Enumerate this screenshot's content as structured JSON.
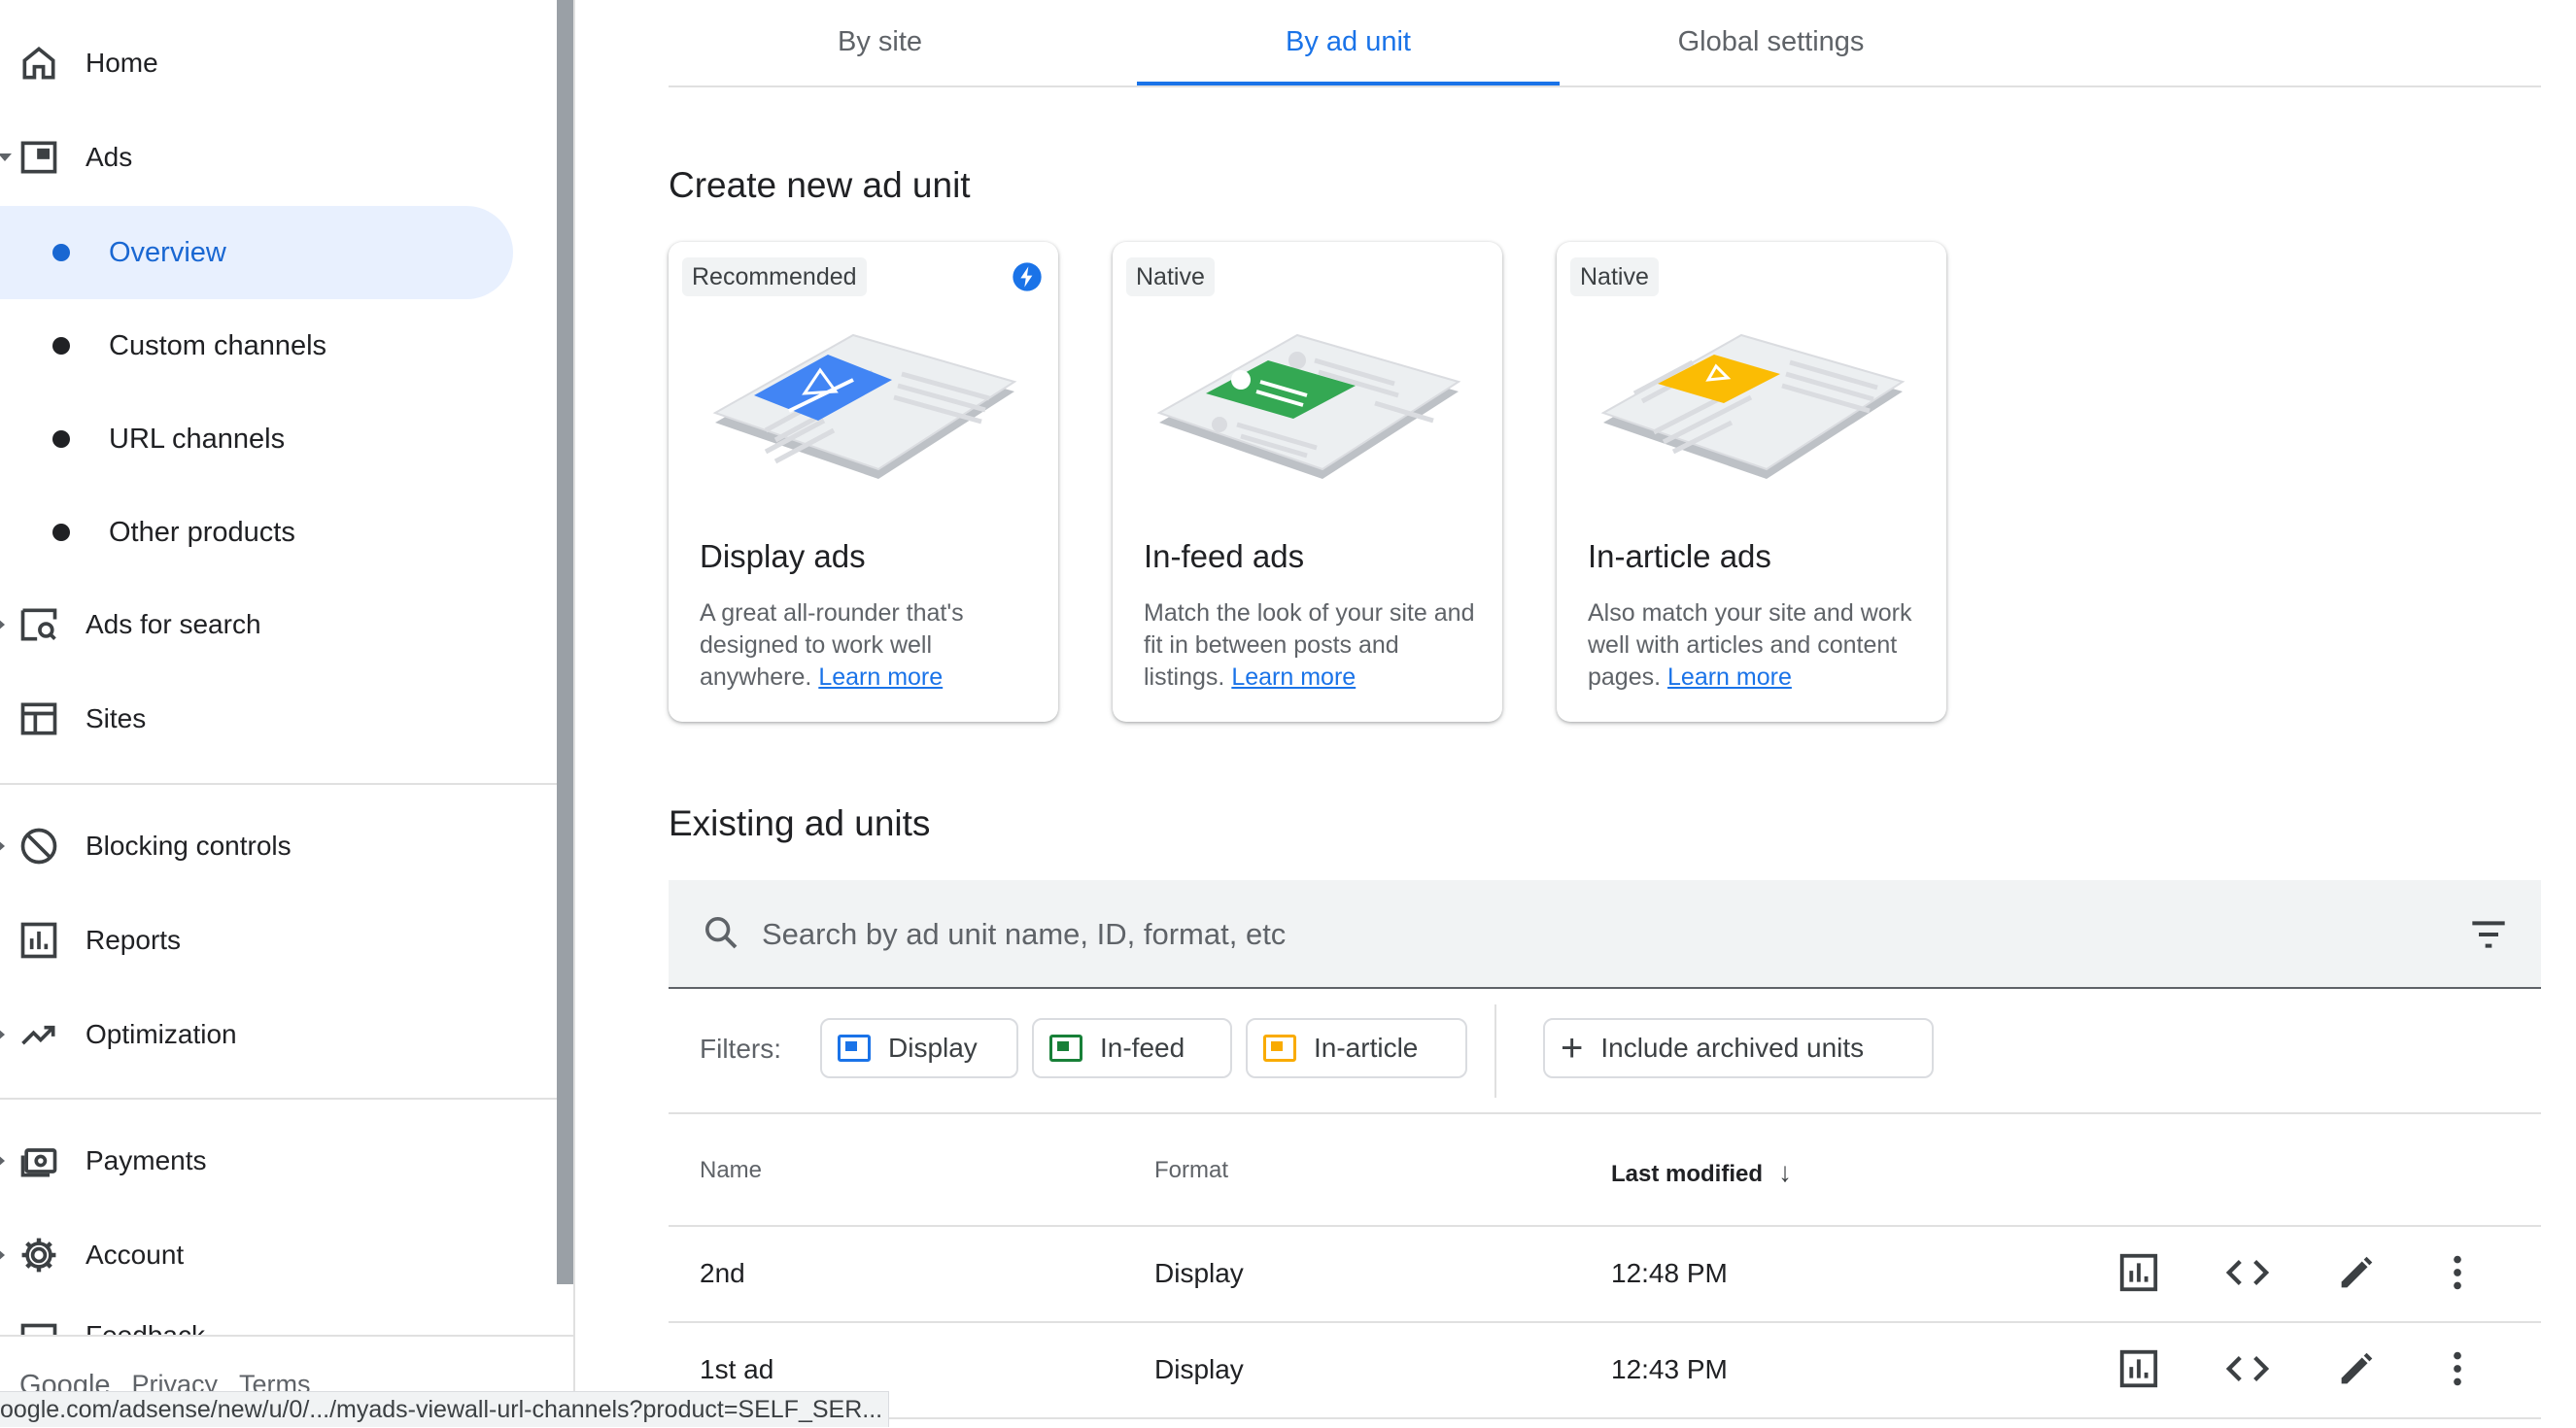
{
  "sidebar": {
    "items": [
      {
        "label": "Home",
        "icon": "home-icon"
      },
      {
        "label": "Ads",
        "icon": "ads-icon"
      },
      {
        "label": "Ads for search",
        "icon": "ads-for-search-icon"
      },
      {
        "label": "Sites",
        "icon": "sites-icon"
      },
      {
        "label": "Blocking controls",
        "icon": "block-icon"
      },
      {
        "label": "Reports",
        "icon": "reports-icon"
      },
      {
        "label": "Optimization",
        "icon": "trending-up-icon"
      },
      {
        "label": "Payments",
        "icon": "payments-icon"
      },
      {
        "label": "Account",
        "icon": "gear-icon"
      },
      {
        "label": "Feedback",
        "icon": "feedback-icon"
      }
    ],
    "sub_items": [
      {
        "label": "Overview",
        "active": true
      },
      {
        "label": "Custom channels"
      },
      {
        "label": "URL channels"
      },
      {
        "label": "Other products"
      }
    ],
    "footer": {
      "google": "Google",
      "privacy": "Privacy",
      "terms": "Terms"
    }
  },
  "status_url": "oogle.com/adsense/new/u/0/.../myads-viewall-url-channels?product=SELF_SER...",
  "tabs": [
    {
      "label": "By site"
    },
    {
      "label": "By ad unit",
      "active": true
    },
    {
      "label": "Global settings"
    }
  ],
  "create": {
    "heading": "Create new ad unit",
    "cards": [
      {
        "badge": "Recommended",
        "title": "Display ads",
        "desc": "A great all-rounder that's designed to work well anywhere.",
        "link": "Learn more",
        "accent": "#4285f4"
      },
      {
        "badge": "Native",
        "title": "In-feed ads",
        "desc": "Match the look of your site and fit in between posts and listings.",
        "link": "Learn more",
        "accent": "#34a853"
      },
      {
        "badge": "Native",
        "title": "In-article ads",
        "desc": "Also match your site and work well with articles and content pages.",
        "link": "Learn more",
        "accent": "#fbbc04"
      }
    ]
  },
  "existing": {
    "heading": "Existing ad units",
    "search_placeholder": "Search by ad unit name, ID, format, etc",
    "filters_label": "Filters:",
    "chips": [
      {
        "label": "Display"
      },
      {
        "label": "In-feed"
      },
      {
        "label": "In-article"
      },
      {
        "label": "Include archived units"
      }
    ],
    "columns": [
      "Name",
      "Format",
      "Last modified"
    ],
    "rows": [
      {
        "name": "2nd",
        "format": "Display",
        "modified": "12:48 PM"
      },
      {
        "name": "1st ad",
        "format": "Display",
        "modified": "12:43 PM"
      }
    ]
  },
  "colors": {
    "accent": "#1a73e8",
    "active_bg": "#e8f0fe",
    "text": "#202124"
  }
}
